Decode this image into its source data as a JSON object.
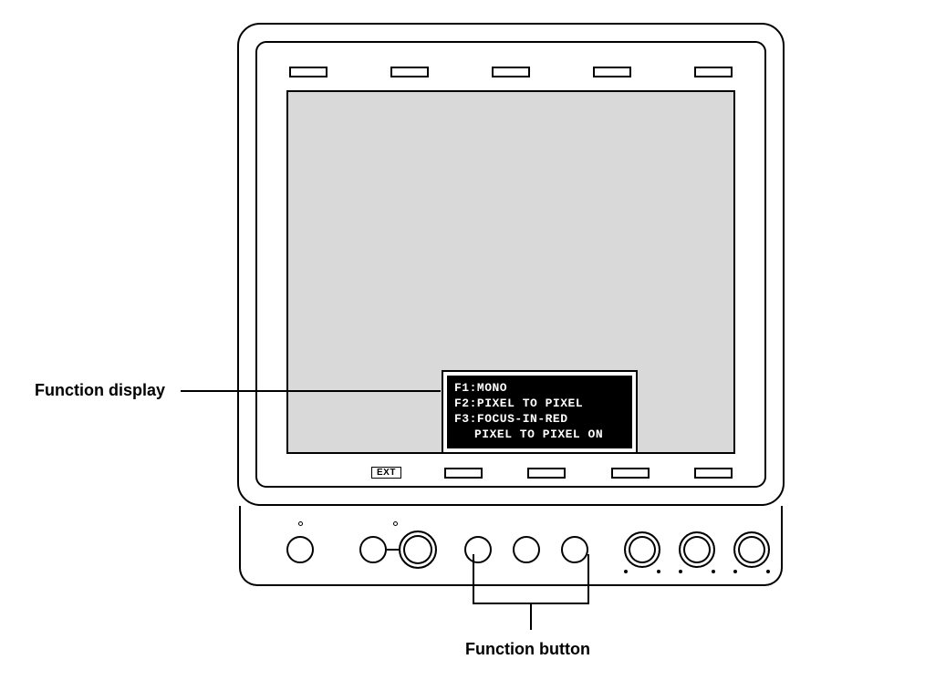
{
  "labels": {
    "function_display": "Function display",
    "function_button": "Function button",
    "ext": "EXT"
  },
  "osd": {
    "line1": "F1:MONO",
    "line2": "F2:PIXEL TO PIXEL",
    "line3": "F3:FOCUS-IN-RED",
    "status": "PIXEL TO PIXEL ON"
  }
}
